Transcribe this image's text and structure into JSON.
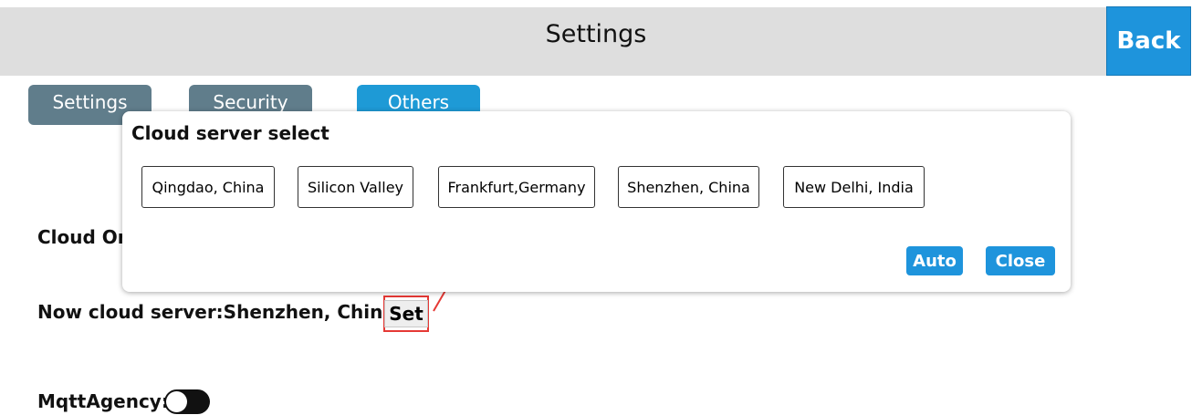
{
  "header": {
    "title": "Settings",
    "back_label": "Back"
  },
  "tabs": [
    {
      "label": "Settings"
    },
    {
      "label": "Security"
    },
    {
      "label": "Others"
    }
  ],
  "content": {
    "cloud_on_label": "Cloud On",
    "now_server_label": "Now cloud server:Shenzhen, China",
    "set_label": "Set",
    "mqtt_label": "MqttAgency:"
  },
  "dialog": {
    "title": "Cloud server select",
    "servers": [
      "Qingdao, China",
      "Silicon Valley",
      "Frankfurt,Germany",
      "Shenzhen, China",
      "New Delhi, India"
    ],
    "auto_label": "Auto",
    "close_label": "Close"
  },
  "colors": {
    "accent": "#1e94dc",
    "tab_inactive": "#607d8b",
    "highlight": "#e53935"
  }
}
